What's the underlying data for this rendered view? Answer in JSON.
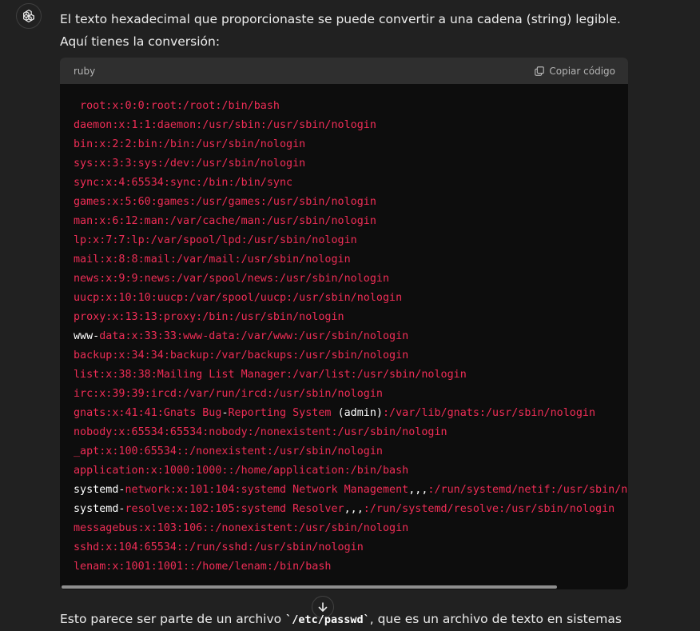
{
  "assistant": {
    "avatar_icon": "openai-logo-icon"
  },
  "message": {
    "intro_text": "El texto hexadecimal que proporcionaste se puede convertir a una cadena (string) legible. Aquí tienes la conversión:",
    "outro_prefix": "Esto parece ser parte de un archivo ",
    "outro_code": "`/etc/passwd`",
    "outro_suffix": ", que es un archivo de texto en sistemas"
  },
  "code_block": {
    "language": "ruby",
    "copy_label": "Copiar código",
    "copy_icon": "clipboard-icon",
    "colors": {
      "main": "#ef2d56",
      "white": "#ffffff",
      "background": "#0d0d0d",
      "header": "#2f2f2f"
    },
    "lines": [
      [
        {
          "t": " root:x:0:0:root:/root:/bin/bash",
          "c": "r"
        }
      ],
      [
        {
          "t": "daemon:x:1:1:daemon:/usr/sbin:/usr/sbin/nologin",
          "c": "r"
        }
      ],
      [
        {
          "t": "bin:x:2:2:bin:/bin:/usr/sbin/nologin",
          "c": "r"
        }
      ],
      [
        {
          "t": "sys:x:3:3:sys:/dev:/usr/sbin/nologin",
          "c": "r"
        }
      ],
      [
        {
          "t": "sync:x:4:65534:sync:/bin:/bin/sync",
          "c": "r"
        }
      ],
      [
        {
          "t": "games:x:5:60:games:/usr/games:/usr/sbin/nologin",
          "c": "r"
        }
      ],
      [
        {
          "t": "man:x:6:12:man:/var/cache/man:/usr/sbin/nologin",
          "c": "r"
        }
      ],
      [
        {
          "t": "lp:x:7:7:lp:/var/spool/lpd:/usr/sbin/nologin",
          "c": "r"
        }
      ],
      [
        {
          "t": "mail:x:8:8:mail:/var/mail:/usr/sbin/nologin",
          "c": "r"
        }
      ],
      [
        {
          "t": "news:x:9:9:news:/var/spool/news:/usr/sbin/nologin",
          "c": "r"
        }
      ],
      [
        {
          "t": "uucp:x:10:10:uucp:/var/spool/uucp:/usr/sbin/nologin",
          "c": "r"
        }
      ],
      [
        {
          "t": "proxy:x:13:13:proxy:/bin:/usr/sbin/nologin",
          "c": "r"
        }
      ],
      [
        {
          "t": "www-",
          "c": "w"
        },
        {
          "t": "data:x:33:33:www-data:/var/www:/usr/sbin/nologin",
          "c": "r"
        }
      ],
      [
        {
          "t": "backup:x:34:34:backup:/var/backups:/usr/sbin/nologin",
          "c": "r"
        }
      ],
      [
        {
          "t": "list:x:38:38:Mailing List Manager:/var/list:/usr/sbin/nologin",
          "c": "r"
        }
      ],
      [
        {
          "t": "irc:x:39:39:ircd:/var/run/ircd:/usr/sbin/nologin",
          "c": "r"
        }
      ],
      [
        {
          "t": "gnats:x:41:41:Gnats Bug",
          "c": "r"
        },
        {
          "t": "-",
          "c": "w"
        },
        {
          "t": "Reporting System ",
          "c": "r"
        },
        {
          "t": "(admin)",
          "c": "w"
        },
        {
          "t": ":/var/lib/gnats:/usr/sbin/nologin",
          "c": "r"
        }
      ],
      [
        {
          "t": "nobody:x:65534:65534:nobody:/nonexistent:/usr/sbin/nologin",
          "c": "r"
        }
      ],
      [
        {
          "t": "_apt:x:100:65534::/nonexistent:/usr/sbin/nologin",
          "c": "r"
        }
      ],
      [
        {
          "t": "application:x:1000:1000::/home/application:/bin/bash",
          "c": "r"
        }
      ],
      [
        {
          "t": "systemd-",
          "c": "w"
        },
        {
          "t": "network:x:101:104:systemd Network Management",
          "c": "r"
        },
        {
          "t": ",,,",
          "c": "w"
        },
        {
          "t": ":/run/systemd/netif:/usr/sbin/nologin",
          "c": "r"
        }
      ],
      [
        {
          "t": "systemd-",
          "c": "w"
        },
        {
          "t": "resolve:x:102:105:systemd Resolver",
          "c": "r"
        },
        {
          "t": ",,,",
          "c": "w"
        },
        {
          "t": ":/run/systemd/resolve:/usr/sbin/nologin",
          "c": "r"
        }
      ],
      [
        {
          "t": "messagebus:x:103:106::/nonexistent:/usr/sbin/nologin",
          "c": "r"
        }
      ],
      [
        {
          "t": "sshd:x:104:65534::/run/sshd:/usr/sbin/nologin",
          "c": "r"
        }
      ],
      [
        {
          "t": "lenam:x:1001:1001::/home/lenam:/bin/bash",
          "c": "r"
        }
      ]
    ]
  },
  "controls": {
    "scroll_down_icon": "arrow-down-icon"
  }
}
